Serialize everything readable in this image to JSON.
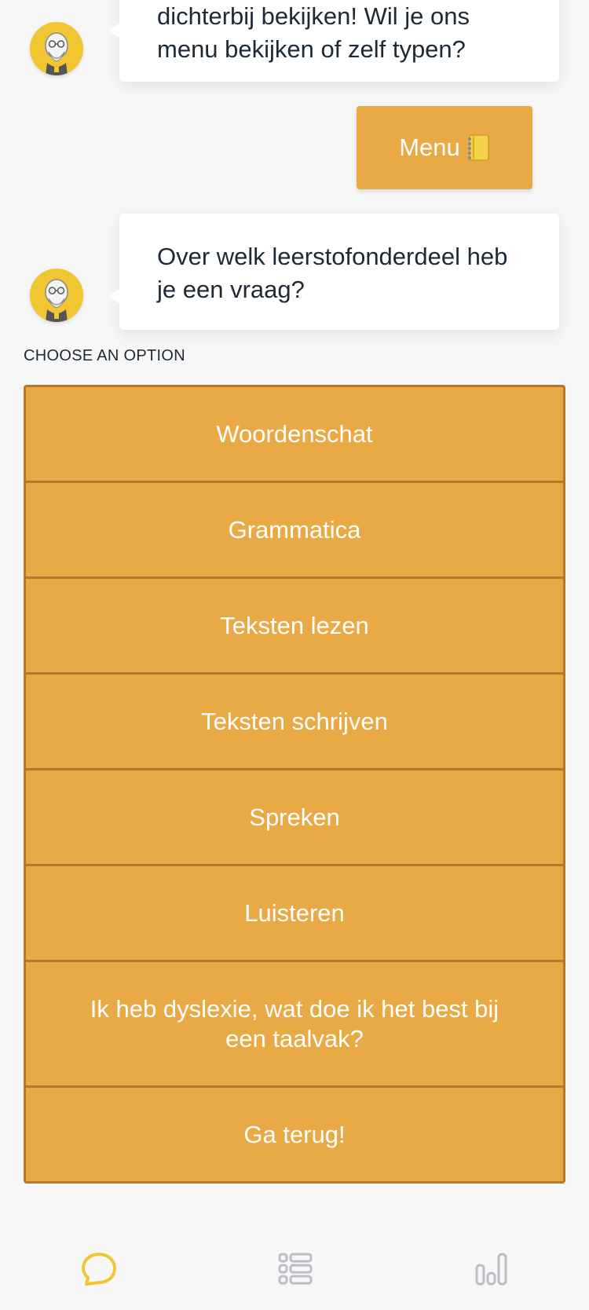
{
  "chat": {
    "messages": [
      {
        "from": "bot",
        "line1": "dichterbij bekijken! Wil je ons",
        "line2": "menu bekijken of zelf typen?"
      },
      {
        "from": "user",
        "text": "Menu",
        "icon": "notebook-icon"
      },
      {
        "from": "bot",
        "line1": "Over welk leerstofonderdeel heb",
        "line2": "je een vraag?"
      }
    ]
  },
  "options": {
    "label": "CHOOSE AN OPTION",
    "items": [
      "Woordenschat",
      "Grammatica",
      "Teksten lezen",
      "Teksten schrijven",
      "Spreken",
      "Luisteren",
      "Ik heb dyslexie, wat doe ik het best bij een taalvak?",
      "Ga terug!"
    ]
  },
  "nav": {
    "items": [
      {
        "icon": "chat-bubble-icon",
        "active": true
      },
      {
        "icon": "list-icon",
        "active": false
      },
      {
        "icon": "bar-chart-icon",
        "active": false
      }
    ]
  },
  "colors": {
    "accent": "#e9a944",
    "accent_border": "#b5782b",
    "nav_active": "#f2c533",
    "nav_inactive": "#b9bec8"
  }
}
